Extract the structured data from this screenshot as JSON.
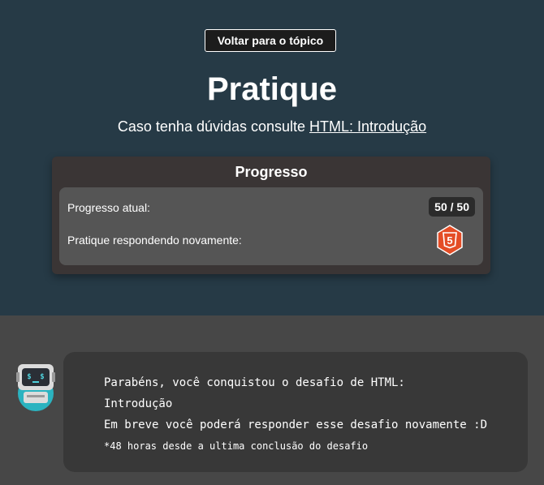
{
  "header": {
    "back_button": "Voltar para o tópico",
    "title": "Pratique",
    "subtitle_prefix": "Caso tenha dúvidas consulte ",
    "subtitle_link": "HTML: Introdução"
  },
  "progress": {
    "title": "Progresso",
    "current_label": "Progresso atual:",
    "current_value": "50 / 50",
    "retry_label": "Pratique respondendo novamente:",
    "badge_text": "5",
    "badge_icon": "html5-icon",
    "badge_color": "#e44d26"
  },
  "message": {
    "line1": "Parabéns, você conquistou o desafio de HTML:",
    "line2": "Introdução",
    "line3": "Em breve você poderá responder esse desafio novamente :D",
    "note": "*48 horas desde a ultima conclusão do desafio",
    "avatar_icon": "robot-icon"
  },
  "colors": {
    "header_bg": "#263a46",
    "body_bg": "#474747",
    "card_bg": "#3a3535",
    "inner_bg": "#555555",
    "message_bg": "#383838",
    "robot_accent": "#2bb3c0"
  }
}
